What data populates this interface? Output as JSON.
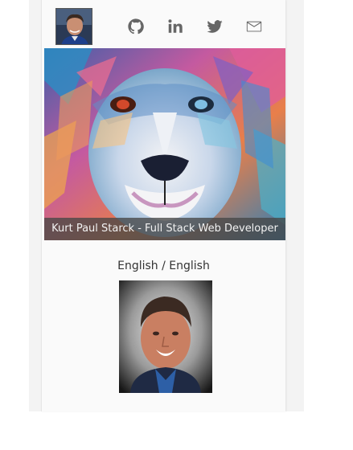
{
  "header": {
    "avatar": "profile-photo",
    "social_links": [
      {
        "name": "github",
        "icon": "github-icon"
      },
      {
        "name": "linkedin",
        "icon": "linkedin-icon"
      },
      {
        "name": "twitter",
        "icon": "twitter-icon"
      },
      {
        "name": "email",
        "icon": "email-icon"
      }
    ]
  },
  "hero": {
    "image": "colorful-lion-painting",
    "caption": "Kurt Paul Starck - Full Stack Web Developer"
  },
  "language": {
    "label": "English / English"
  },
  "portrait": {
    "image": "profile-portrait"
  },
  "colors": {
    "icon": "#666666",
    "caption_bg": "#464646",
    "card_bg": "#fafafa"
  }
}
